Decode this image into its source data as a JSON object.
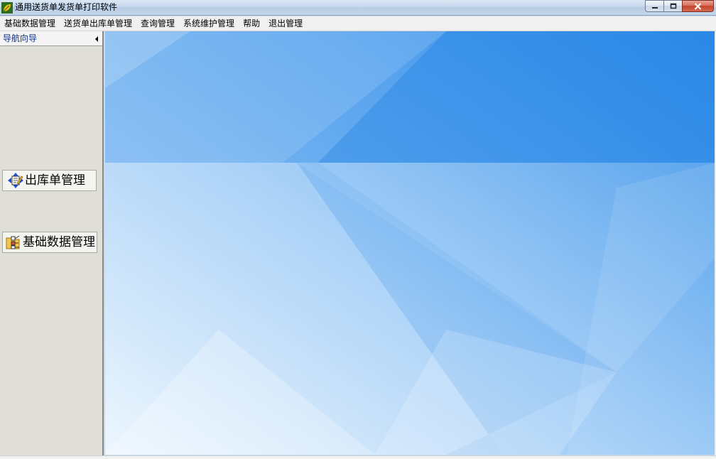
{
  "window": {
    "title": "通用送货单发货单打印软件",
    "app_icon": "leaf-app-icon",
    "controls": {
      "minimize_icon": "minimize-icon",
      "maximize_icon": "maximize-icon",
      "close_icon": "close-icon"
    }
  },
  "menubar": {
    "items": [
      {
        "label": "基础数据管理"
      },
      {
        "label": "送货单出库单管理"
      },
      {
        "label": "查询管理"
      },
      {
        "label": "系统维护管理"
      },
      {
        "label": "帮助"
      },
      {
        "label": "退出管理"
      }
    ]
  },
  "nav": {
    "title": "导航向导",
    "collapse_icon": "collapse-left-arrow-icon",
    "buttons": [
      {
        "label": "出库单管理",
        "icon": "outbound-document-icon"
      },
      {
        "label": "基础数据管理",
        "icon": "base-data-folder-icon"
      }
    ]
  },
  "colors": {
    "background_light": "#eaf5fe",
    "background_blue": "#2a8ae8",
    "nav_bg": "#dfdfd7",
    "nav_title": "#0c2f86"
  }
}
